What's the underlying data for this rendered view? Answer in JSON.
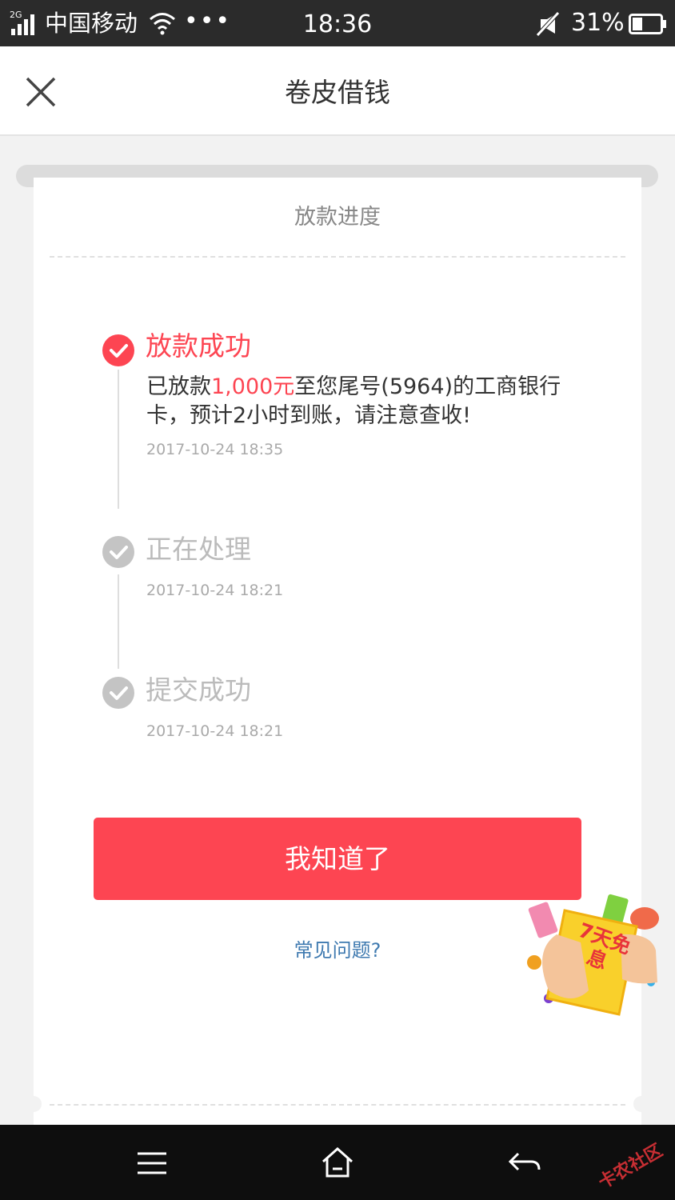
{
  "status_bar": {
    "network_type": "2G",
    "carrier": "中国移动",
    "more_dots": "•••",
    "time": "18:36",
    "battery_percent": "31%"
  },
  "header": {
    "title": "卷皮借钱"
  },
  "card": {
    "title": "放款进度"
  },
  "steps": [
    {
      "title": "放款成功",
      "desc_prefix": "已放款",
      "desc_amount": "1,000元",
      "desc_suffix": "至您尾号(5964)的工商银行卡，预计2小时到账，请注意查收!",
      "time": "2017-10-24 18:35",
      "status": "done"
    },
    {
      "title": "正在处理",
      "time": "2017-10-24 18:21",
      "status": "past"
    },
    {
      "title": "提交成功",
      "time": "2017-10-24 18:21",
      "status": "past"
    }
  ],
  "confirm_button": "我知道了",
  "faq_link": "常见问题?",
  "promo": {
    "text": "7天免息"
  },
  "watermark": "卡农社区",
  "colors": {
    "accent": "#fd4552",
    "link": "#3f7ab0",
    "inactive": "#c4c4c4"
  }
}
